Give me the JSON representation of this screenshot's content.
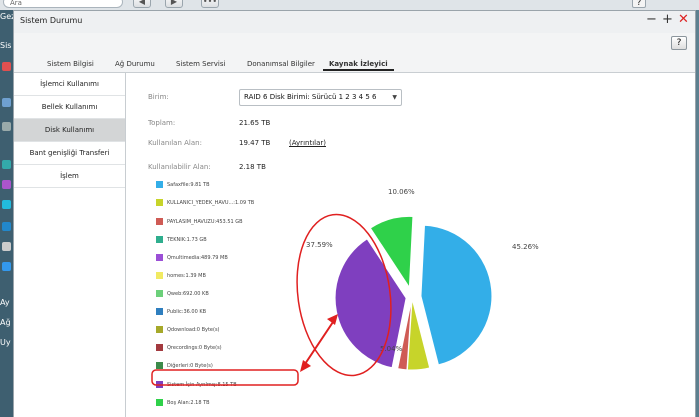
{
  "desktop": {
    "search_placeholder": "Ara",
    "side_labels": [
      "Gez",
      "Sis",
      "Ay",
      "Ağ",
      "Uy"
    ]
  },
  "window": {
    "title": "Sistem Durumu",
    "help": "?",
    "tabs": [
      {
        "label": "Sistem Bilgisi",
        "active": false
      },
      {
        "label": "Ağ Durumu",
        "active": false
      },
      {
        "label": "Sistem Servisi",
        "active": false
      },
      {
        "label": "Donanımsal Bilgiler",
        "active": false
      },
      {
        "label": "Kaynak İzleyici",
        "active": true
      }
    ]
  },
  "sidebar": {
    "items": [
      {
        "label": "İşlemci Kullanımı",
        "active": false
      },
      {
        "label": "Bellek Kullanımı",
        "active": false
      },
      {
        "label": "Disk Kullanımı",
        "active": true
      },
      {
        "label": "Bant genişliği Transferi",
        "active": false
      },
      {
        "label": "İşlem",
        "active": false
      }
    ]
  },
  "disk": {
    "unit_label": "Birim:",
    "unit_value": "RAID 6 Disk Birimi: Sürücü 1 2 3 4 5 6",
    "total_label": "Toplam:",
    "total_value": "21.65 TB",
    "used_label": "Kullanılan Alan:",
    "used_value": "19.47 TB",
    "details_link": "(Ayrıntılar)",
    "avail_label": "Kullanılabilir Alan:",
    "avail_value": "2.18 TB"
  },
  "legend": [
    {
      "label": "Safaxfile:9.81 TB",
      "color": "#33aee8"
    },
    {
      "label": "KULLANICI_YEDEK_HAVU...:1.09 TB",
      "color": "#c7d42a"
    },
    {
      "label": "PAYLASIM_HAVUZU:453.51 GB",
      "color": "#cf5b55"
    },
    {
      "label": "TEKNIK:1.73 GB",
      "color": "#2fae8e"
    },
    {
      "label": "Qmultimedia:489.79 MB",
      "color": "#9b4fd6"
    },
    {
      "label": "homes:1.39 MB",
      "color": "#f1ea62"
    },
    {
      "label": "Qweb:692.00 KB",
      "color": "#6cd07a"
    },
    {
      "label": "Public:36.00 KB",
      "color": "#2f7fbf"
    },
    {
      "label": "Qdownload:0 Byte(s)",
      "color": "#a6a92a"
    },
    {
      "label": "Qrecordings:0 Byte(s)",
      "color": "#a33a3f"
    },
    {
      "label": "Diğerleri:0 Byte(s)",
      "color": "#3c8a4a"
    },
    {
      "label": "Sistem İçin Ayrılmış:8.15 TB",
      "color": "#7f3fbf"
    },
    {
      "label": "Boş Alan:2.18 TB",
      "color": "#2fd14a"
    }
  ],
  "chart_data": {
    "type": "pie",
    "slices": [
      {
        "name": "Safaxfile",
        "value": 45.26,
        "label": "45.26%",
        "color": "#33aee8"
      },
      {
        "name": "KULLANICI_YEDEK_HAVU...",
        "value": 5.04,
        "label": "5.04%",
        "color": "#c7d42a"
      },
      {
        "name": "PAYLASIM_HAVUZU",
        "value": 2.09,
        "label": "",
        "color": "#cf5b55"
      },
      {
        "name": "Sistem İçin Ayrılmış",
        "value": 37.59,
        "label": "37.59%",
        "color": "#7f3fbf"
      },
      {
        "name": "Boş Alan",
        "value": 10.06,
        "label": "10.06%",
        "color": "#2fd14a"
      }
    ]
  }
}
